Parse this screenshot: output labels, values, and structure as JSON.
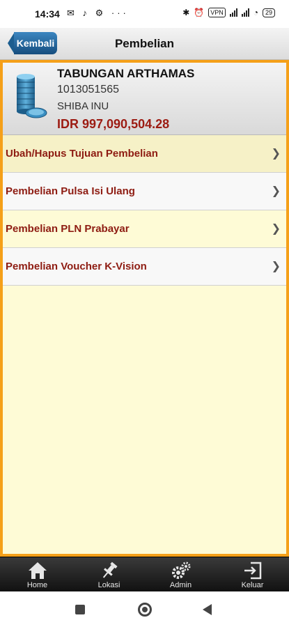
{
  "status_bar": {
    "time": "14:34",
    "left_icons": "✉ ♪ ⚙ ···",
    "bluetooth": "✱",
    "alarm": "⏰",
    "vpn": "VPN",
    "wifi": "◔",
    "battery": "29"
  },
  "header": {
    "back_label": "Kembali",
    "title": "Pembelian"
  },
  "account": {
    "name": "TABUNGAN ARTHAMAS",
    "number": "1013051565",
    "holder": "SHIBA INU",
    "balance": "IDR 997,090,504.28"
  },
  "menu": {
    "items": [
      {
        "label": "Ubah/Hapus Tujuan Pembelian"
      },
      {
        "label": "Pembelian Pulsa Isi Ulang"
      },
      {
        "label": "Pembelian PLN Prabayar"
      },
      {
        "label": "Pembelian Voucher K-Vision"
      }
    ],
    "chevron": "❯"
  },
  "tabbar": {
    "tabs": [
      {
        "label": "Home",
        "icon": "home-icon"
      },
      {
        "label": "Lokasi",
        "icon": "pin-icon"
      },
      {
        "label": "Admin",
        "icon": "gears-icon"
      },
      {
        "label": "Keluar",
        "icon": "logout-icon"
      }
    ]
  },
  "colors": {
    "frame": "#f5a019",
    "content_bg": "#fefbd6",
    "menu_text": "#8e1c12",
    "balance": "#9c1b12",
    "back_button": "#1c5d8f"
  }
}
